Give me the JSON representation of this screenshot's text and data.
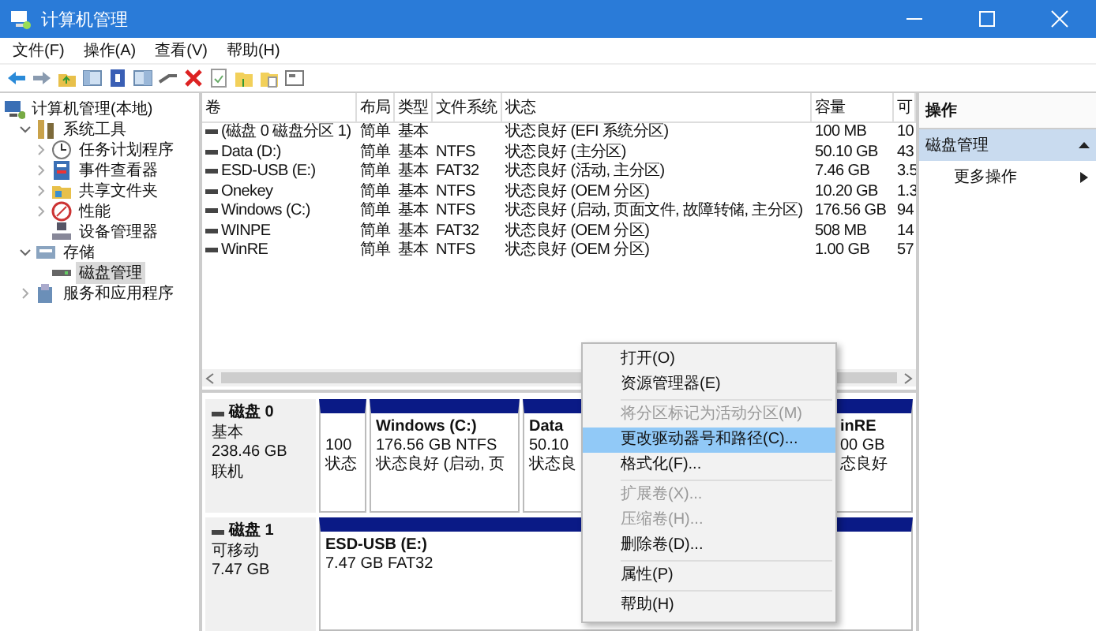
{
  "window": {
    "title": "计算机管理"
  },
  "menu_bar": [
    "文件(F)",
    "操作(A)",
    "查看(V)",
    "帮助(H)"
  ],
  "tree": [
    {
      "label": "计算机管理(本地)",
      "selected": false,
      "children": [
        {
          "label": "系统工具",
          "expanded": true,
          "selected": false,
          "children": [
            {
              "label": "任务计划程序",
              "expanded": false,
              "selected": false
            },
            {
              "label": "事件查看器",
              "expanded": false,
              "selected": false
            },
            {
              "label": "共享文件夹",
              "expanded": false,
              "selected": false
            },
            {
              "label": "性能",
              "expanded": false,
              "selected": false
            },
            {
              "label": "设备管理器",
              "selected": false
            }
          ]
        },
        {
          "label": "存储",
          "expanded": true,
          "selected": false,
          "children": [
            {
              "label": "磁盘管理",
              "selected": true
            }
          ]
        },
        {
          "label": "服务和应用程序",
          "expanded": false,
          "selected": false
        }
      ]
    }
  ],
  "volumes": {
    "columns": [
      "卷",
      "布局",
      "类型",
      "文件系统",
      "状态",
      "容量",
      "可"
    ],
    "rows": [
      [
        "(磁盘 0 磁盘分区 1)",
        "简单",
        "基本",
        "",
        "状态良好 (EFI 系统分区)",
        "100 MB",
        "10"
      ],
      [
        "Data (D:)",
        "简单",
        "基本",
        "NTFS",
        "状态良好 (主分区)",
        "50.10 GB",
        "43"
      ],
      [
        "ESD-USB (E:)",
        "简单",
        "基本",
        "FAT32",
        "状态良好 (活动, 主分区)",
        "7.46 GB",
        "3.5"
      ],
      [
        "Onekey",
        "简单",
        "基本",
        "NTFS",
        "状态良好 (OEM 分区)",
        "10.20 GB",
        "1.3"
      ],
      [
        "Windows (C:)",
        "简单",
        "基本",
        "NTFS",
        "状态良好 (启动, 页面文件, 故障转储, 主分区)",
        "176.56 GB",
        "94"
      ],
      [
        "WINPE",
        "简单",
        "基本",
        "FAT32",
        "状态良好 (OEM 分区)",
        "508 MB",
        "14"
      ],
      [
        "WinRE",
        "简单",
        "基本",
        "NTFS",
        "状态良好 (OEM 分区)",
        "1.00 GB",
        "57"
      ]
    ]
  },
  "disks": [
    {
      "name": "磁盘 0",
      "info": [
        "基本",
        "238.46 GB",
        "联机"
      ],
      "partitions": [
        {
          "lines": [
            "100",
            "状态"
          ]
        },
        {
          "title": "Windows  (C:)",
          "lines": [
            "176.56 GB NTFS",
            "状态良好 (启动, 页"
          ]
        },
        {
          "title": "Data",
          "lines": [
            "50.10",
            "状态良"
          ]
        },
        {
          "title": "inRE",
          "lines": [
            "00 GB",
            "态良好"
          ]
        }
      ]
    },
    {
      "name": "磁盘 1",
      "info": [
        "可移动",
        "7.47 GB"
      ],
      "partitions": [
        {
          "title": "ESD-USB  (E:)",
          "lines": [
            "7.47 GB FAT32"
          ]
        }
      ]
    }
  ],
  "context_menu": [
    {
      "kind": "item",
      "label": "打开(O)",
      "disabled": false,
      "selected": false
    },
    {
      "kind": "item",
      "label": "资源管理器(E)",
      "disabled": false,
      "selected": false
    },
    {
      "kind": "separator"
    },
    {
      "kind": "item",
      "label": "将分区标记为活动分区(M)",
      "disabled": true,
      "selected": false
    },
    {
      "kind": "item",
      "label": "更改驱动器号和路径(C)...",
      "disabled": false,
      "selected": true
    },
    {
      "kind": "item",
      "label": "格式化(F)...",
      "disabled": false,
      "selected": false
    },
    {
      "kind": "separator"
    },
    {
      "kind": "item",
      "label": "扩展卷(X)...",
      "disabled": true,
      "selected": false
    },
    {
      "kind": "item",
      "label": "压缩卷(H)...",
      "disabled": true,
      "selected": false
    },
    {
      "kind": "item",
      "label": "删除卷(D)...",
      "disabled": false,
      "selected": false
    },
    {
      "kind": "separator"
    },
    {
      "kind": "item",
      "label": "属性(P)",
      "disabled": false,
      "selected": false
    },
    {
      "kind": "separator"
    },
    {
      "kind": "item",
      "label": "帮助(H)",
      "disabled": false,
      "selected": false
    }
  ],
  "actions": {
    "title": "操作",
    "section": {
      "label": "磁盘管理",
      "expanded": true
    },
    "items": [
      {
        "label": "更多操作"
      }
    ]
  }
}
